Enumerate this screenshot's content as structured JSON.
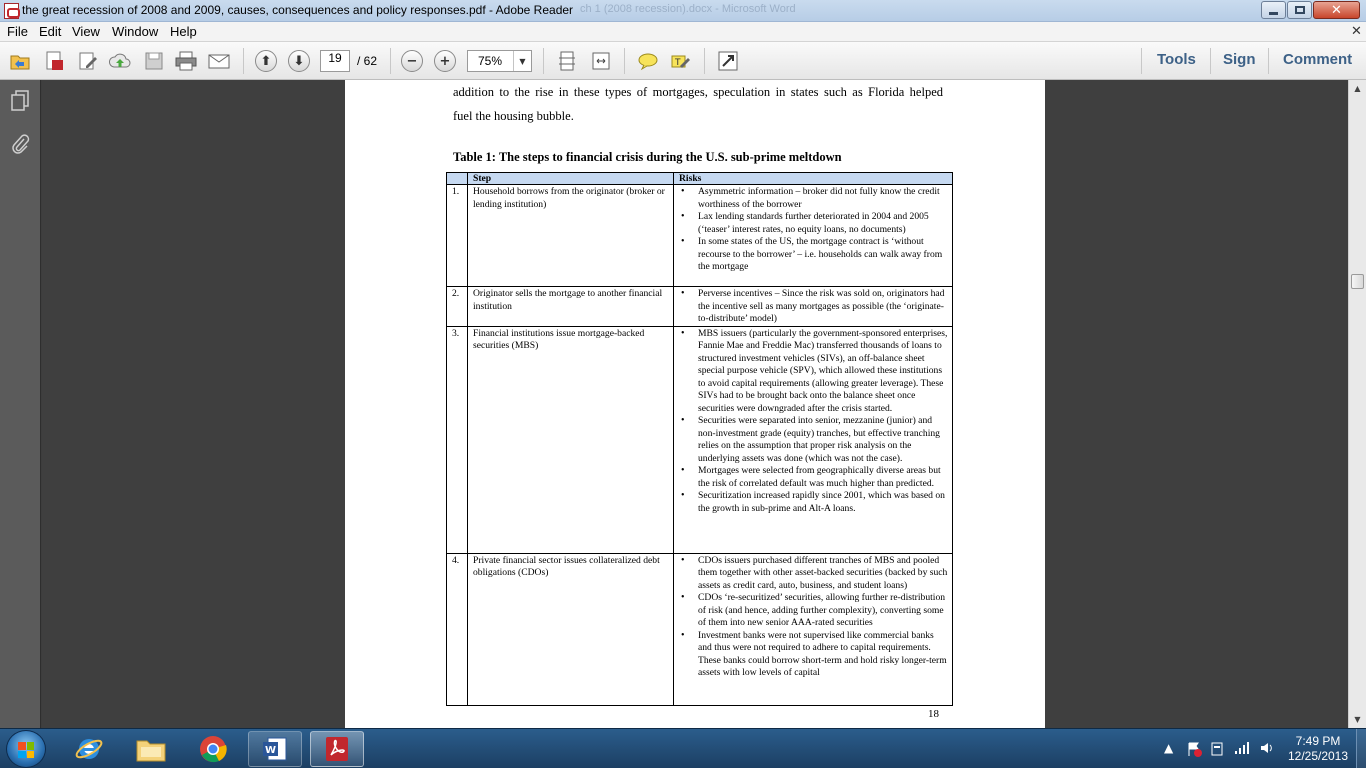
{
  "window": {
    "title": "the great recession of 2008 and 2009, causes, consequences and policy responses.pdf - Adobe Reader",
    "ghost_title": "ch 1 (2008 recession).docx - Microsoft Word"
  },
  "menu": [
    "File",
    "Edit",
    "View",
    "Window",
    "Help"
  ],
  "toolbar": {
    "page_current": "19",
    "page_total": "/ 62",
    "zoom": "75%",
    "right_buttons": [
      "Tools",
      "Sign",
      "Comment"
    ]
  },
  "document": {
    "intro_line1": "addition to the rise in these types of mortgages, speculation in states such as Florida helped",
    "intro_line2": "fuel the housing bubble.",
    "table_title": "Table 1: The steps to financial crisis during the U.S. sub-prime meltdown",
    "table": {
      "headers": [
        "",
        "Step",
        "Risks"
      ],
      "rows": [
        {
          "num": "1.",
          "step": "Household borrows from the originator (broker or lending institution)",
          "risks": [
            "Asymmetric information – broker did not fully know the credit worthiness of the borrower",
            "Lax lending standards further deteriorated in 2004 and 2005 (‘teaser’ interest rates, no equity loans, no documents)",
            "In some states of the US, the mortgage contract is ‘without recourse to the borrower’ – i.e. households can walk away from the mortgage"
          ]
        },
        {
          "num": "2.",
          "step": "Originator sells the mortgage to another financial institution",
          "risks": [
            "Perverse incentives – Since the risk was sold on, originators had the incentive sell as many mortgages as possible (the ‘originate-to-distribute’ model)"
          ]
        },
        {
          "num": "3.",
          "step": "Financial institutions issue mortgage-backed securities (MBS)",
          "risks": [
            "MBS issuers (particularly the government-sponsored enterprises, Fannie Mae and Freddie Mac) transferred thousands of loans to structured investment vehicles (SIVs), an off-balance sheet special purpose vehicle (SPV), which allowed these institutions to avoid capital requirements (allowing greater leverage). These SIVs had to be brought back onto the balance sheet once securities were downgraded after the crisis started.",
            "Securities were separated into senior, mezzanine (junior) and non-investment grade (equity) tranches, but effective tranching relies on the assumption that proper risk analysis on the underlying assets was done (which was not the case).",
            "Mortgages were selected from geographically diverse areas but the risk of correlated default was much higher than predicted.",
            "Securitization increased rapidly since 2001, which was based on the growth in sub-prime and Alt-A loans."
          ]
        },
        {
          "num": "4.",
          "step": "Private financial sector issues collateralized debt obligations (CDOs)",
          "risks": [
            "CDOs issuers purchased different tranches of MBS and pooled them together with other asset-backed securities (backed by such assets as credit card, auto, business, and student loans)",
            "CDOs ‘re-securitized’ securities, allowing further re-distribution of risk (and hence, adding further complexity), converting some of them into new senior AAA-rated securities",
            "Investment banks were not supervised like commercial banks and thus were not required to adhere to capital requirements. These banks could borrow short-term and hold risky longer-term assets with low levels of capital"
          ]
        }
      ]
    },
    "page_number": "18"
  },
  "taskbar": {
    "clock_time": "7:49 PM",
    "clock_date": "12/25/2013"
  },
  "colors": {
    "table_header_bg": "#c6d9f1",
    "acrobat_red": "#c1272d",
    "toolbar_link": "#3d6187"
  }
}
